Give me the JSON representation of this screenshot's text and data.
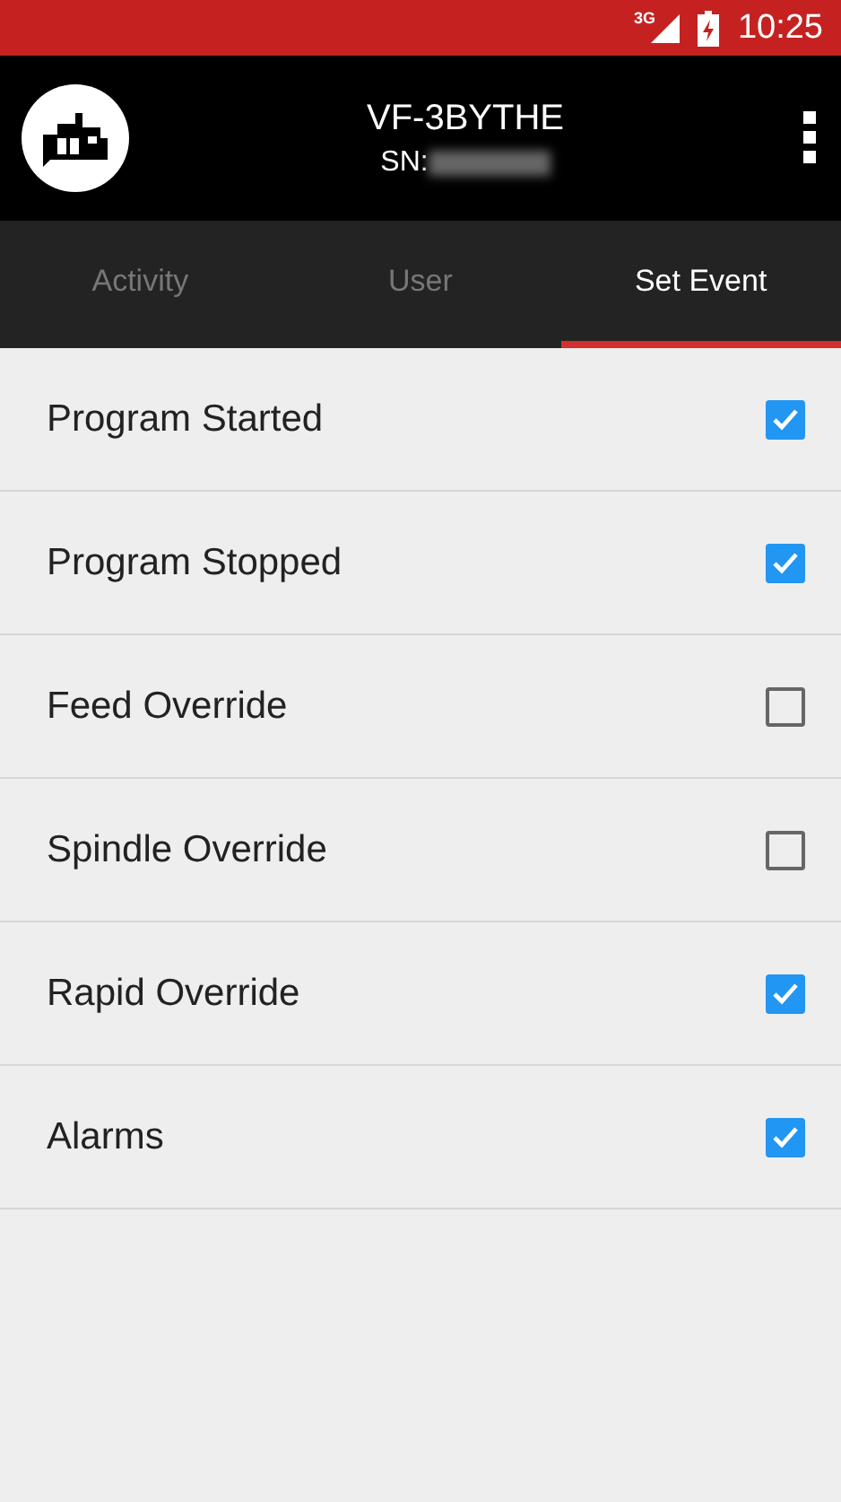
{
  "status_bar": {
    "network": "3G",
    "time": "10:25"
  },
  "app_bar": {
    "title": "VF-3BYTHE",
    "serial_label": "SN:"
  },
  "tabs": [
    {
      "label": "Activity",
      "selected": false
    },
    {
      "label": "User",
      "selected": false
    },
    {
      "label": "Set Event",
      "selected": true
    }
  ],
  "events": [
    {
      "label": "Program Started",
      "checked": true
    },
    {
      "label": "Program Stopped",
      "checked": true
    },
    {
      "label": "Feed Override",
      "checked": false
    },
    {
      "label": "Spindle Override",
      "checked": false
    },
    {
      "label": "Rapid Override",
      "checked": true
    },
    {
      "label": "Alarms",
      "checked": true
    }
  ]
}
